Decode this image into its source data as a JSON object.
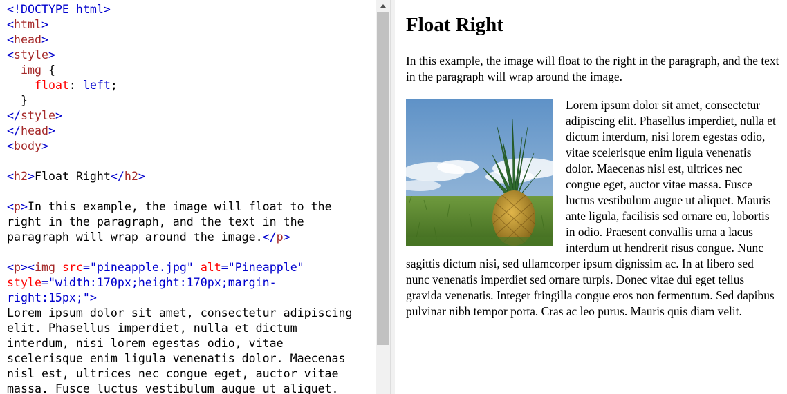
{
  "editor": {
    "lines": [
      [
        {
          "c": "t-punct",
          "t": "<!DOCTYPE html>"
        }
      ],
      [
        {
          "c": "t-punct",
          "t": "<"
        },
        {
          "c": "t-tag",
          "t": "html"
        },
        {
          "c": "t-punct",
          "t": ">"
        }
      ],
      [
        {
          "c": "t-punct",
          "t": "<"
        },
        {
          "c": "t-tag",
          "t": "head"
        },
        {
          "c": "t-punct",
          "t": ">"
        }
      ],
      [
        {
          "c": "t-punct",
          "t": "<"
        },
        {
          "c": "t-tag",
          "t": "style"
        },
        {
          "c": "t-punct",
          "t": ">"
        }
      ],
      [
        {
          "c": "t-text",
          "t": "  "
        },
        {
          "c": "t-sel",
          "t": "img"
        },
        {
          "c": "t-text",
          "t": " {"
        }
      ],
      [
        {
          "c": "t-text",
          "t": "    "
        },
        {
          "c": "t-prop",
          "t": "float"
        },
        {
          "c": "t-text",
          "t": ": "
        },
        {
          "c": "t-pval",
          "t": "left"
        },
        {
          "c": "t-text",
          "t": ";"
        }
      ],
      [
        {
          "c": "t-text",
          "t": "  }"
        }
      ],
      [
        {
          "c": "t-punct",
          "t": "</"
        },
        {
          "c": "t-tag",
          "t": "style"
        },
        {
          "c": "t-punct",
          "t": ">"
        }
      ],
      [
        {
          "c": "t-punct",
          "t": "</"
        },
        {
          "c": "t-tag",
          "t": "head"
        },
        {
          "c": "t-punct",
          "t": ">"
        }
      ],
      [
        {
          "c": "t-punct",
          "t": "<"
        },
        {
          "c": "t-tag",
          "t": "body"
        },
        {
          "c": "t-punct",
          "t": ">"
        }
      ],
      [
        {
          "c": "t-text",
          "t": ""
        }
      ],
      [
        {
          "c": "t-punct",
          "t": "<"
        },
        {
          "c": "t-tag",
          "t": "h2"
        },
        {
          "c": "t-punct",
          "t": ">"
        },
        {
          "c": "t-text",
          "t": "Float Right"
        },
        {
          "c": "t-punct",
          "t": "</"
        },
        {
          "c": "t-tag",
          "t": "h2"
        },
        {
          "c": "t-punct",
          "t": ">"
        }
      ],
      [
        {
          "c": "t-text",
          "t": ""
        }
      ],
      [
        {
          "c": "t-punct",
          "t": "<"
        },
        {
          "c": "t-tag",
          "t": "p"
        },
        {
          "c": "t-punct",
          "t": ">"
        },
        {
          "c": "t-text",
          "t": "In this example, the image will float to the"
        }
      ],
      [
        {
          "c": "t-text",
          "t": "right in the paragraph, and the text in the"
        }
      ],
      [
        {
          "c": "t-text",
          "t": "paragraph will wrap around the image."
        },
        {
          "c": "t-punct",
          "t": "</"
        },
        {
          "c": "t-tag",
          "t": "p"
        },
        {
          "c": "t-punct",
          "t": ">"
        }
      ],
      [
        {
          "c": "t-text",
          "t": ""
        }
      ],
      [
        {
          "c": "t-punct",
          "t": "<"
        },
        {
          "c": "t-tag",
          "t": "p"
        },
        {
          "c": "t-punct",
          "t": "><"
        },
        {
          "c": "t-tag",
          "t": "img"
        },
        {
          "c": "t-text",
          "t": " "
        },
        {
          "c": "t-attr",
          "t": "src"
        },
        {
          "c": "t-val",
          "t": "=\"pineapple.jpg\""
        },
        {
          "c": "t-text",
          "t": " "
        },
        {
          "c": "t-attr",
          "t": "alt"
        },
        {
          "c": "t-val",
          "t": "=\"Pineapple\""
        }
      ],
      [
        {
          "c": "t-attr",
          "t": "style"
        },
        {
          "c": "t-val",
          "t": "=\"width:170px;height:170px;margin-"
        }
      ],
      [
        {
          "c": "t-val",
          "t": "right:15px;\""
        },
        {
          "c": "t-punct",
          "t": ">"
        }
      ],
      [
        {
          "c": "t-text",
          "t": "Lorem ipsum dolor sit amet, consectetur adipiscing"
        }
      ],
      [
        {
          "c": "t-text",
          "t": "elit. Phasellus imperdiet, nulla et dictum"
        }
      ],
      [
        {
          "c": "t-text",
          "t": "interdum, nisi lorem egestas odio, vitae"
        }
      ],
      [
        {
          "c": "t-text",
          "t": "scelerisque enim ligula venenatis dolor. Maecenas"
        }
      ],
      [
        {
          "c": "t-text",
          "t": "nisl est, ultrices nec congue eget, auctor vitae"
        }
      ],
      [
        {
          "c": "t-text",
          "t": "massa. Fusce luctus vestibulum augue ut aliquet."
        }
      ]
    ]
  },
  "result": {
    "heading": "Float Right",
    "intro": "In this example, the image will float to the right in the paragraph, and the text in the paragraph will wrap around the image.",
    "image_alt": "Pineapple",
    "body": "Lorem ipsum dolor sit amet, consectetur adipiscing elit. Phasellus imperdiet, nulla et dictum interdum, nisi lorem egestas odio, vitae scelerisque enim ligula venenatis dolor. Maecenas nisl est, ultrices nec congue eget, auctor vitae massa. Fusce luctus vestibulum augue ut aliquet. Mauris ante ligula, facilisis sed ornare eu, lobortis in odio. Praesent convallis urna a lacus interdum ut hendrerit risus congue. Nunc sagittis dictum nisi, sed ullamcorper ipsum dignissim ac. In at libero sed nunc venenatis imperdiet sed ornare turpis. Donec vitae dui eget tellus gravida venenatis. Integer fringilla congue eros non fermentum. Sed dapibus pulvinar nibh tempor porta. Cras ac leo purus. Mauris quis diam velit."
  },
  "colors": {
    "tag": "#a52a2a",
    "punct": "#0000cd",
    "attr": "#ff0000",
    "value": "#0000cd",
    "scroll_thumb": "#c1c1c1",
    "scroll_track": "#f1f1f1"
  },
  "icons": {
    "scroll_up": "triangle-up-icon"
  }
}
